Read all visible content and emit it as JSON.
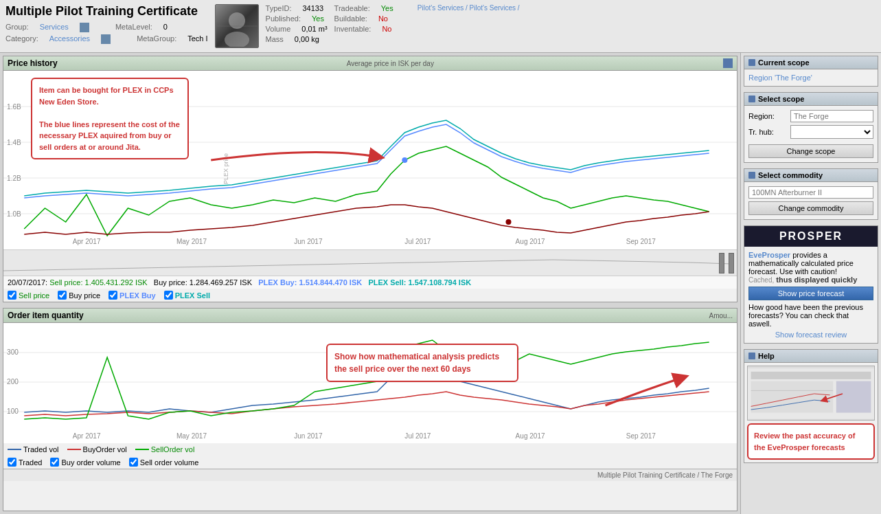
{
  "header": {
    "title": "Multiple Pilot Training Certificate",
    "avatar_alt": "Item Avatar",
    "group_label": "Group:",
    "group_value": "Services",
    "metalevel_label": "MetaLevel:",
    "metalevel_value": "0",
    "category_label": "Category:",
    "category_value": "Accessories",
    "metagroup_label": "MetaGroup:",
    "metagroup_value": "Tech I",
    "typeid_label": "TypeID:",
    "typeid_value": "34133",
    "published_label": "Published:",
    "published_value": "Yes",
    "volume_label": "Volume",
    "volume_value": "0,01 m³",
    "mass_label": "Mass",
    "mass_value": "0,00 kg",
    "tradeable_label": "Tradeable:",
    "tradeable_value": "Yes",
    "buildable_label": "Buildable:",
    "buildable_value": "No",
    "inventable_label": "Inventable:",
    "inventable_value": "No",
    "breadcrumb": "Pilot's Services / Pilot's Services /"
  },
  "price_history": {
    "title": "Price history",
    "avg_label": "Average price in ISK per day",
    "tooltip1": "Item can be bought for PLEX in CCPs New Eden Store.\n\nThe blue lines represent the cost of the necessary PLEX aquired from buy or sell orders at or around Jita.",
    "date_label": "20/07/2017:",
    "sell_label": "Sell price:",
    "sell_value": "1.405.431.292 ISK",
    "buy_label": "Buy price:",
    "buy_value": "1.284.469.257 ISK",
    "plex_buy_label": "PLEX Buy:",
    "plex_buy_value": "1.514.844.470 ISK",
    "plex_sell_label": "PLEX Sell:",
    "plex_sell_value": "1.547.108.794 ISK",
    "cb_sell": "Sell price",
    "cb_buy": "Buy price",
    "cb_plex_buy": "PLEX Buy",
    "cb_plex_sell": "PLEX Sell",
    "x_labels": [
      "Apr 2017",
      "May 2017",
      "Jun 2017",
      "Jul 2017",
      "Aug 2017",
      "Sep 2017"
    ]
  },
  "order_quantity": {
    "title": "Order item quantity",
    "amount_label": "Amou...",
    "legend_traded": "Traded vol",
    "legend_buy": "BuyOrder vol",
    "legend_sell": "SellOrder vol",
    "cb_traded": "Traded",
    "cb_buy_vol": "Buy order volume",
    "cb_sell_vol": "Sell order volume",
    "footer": "Multiple Pilot Training Certificate / The Forge",
    "x_labels": [
      "Apr 2017",
      "May 2017",
      "Jun 2017",
      "Jul 2017",
      "Aug 2017",
      "Sep 2017"
    ],
    "callout": "Show how mathematical analysis predicts the sell price over the next 60 days"
  },
  "sidebar": {
    "current_scope": {
      "title": "Current scope",
      "region": "Region 'The Forge'"
    },
    "select_scope": {
      "title": "Select scope",
      "region_label": "Region:",
      "region_placeholder": "The Forge",
      "trhub_label": "Tr. hub:",
      "button_label": "Change scope"
    },
    "select_commodity": {
      "title": "Select commodity",
      "input_placeholder": "100MN Afterburner II",
      "button_label": "Change commodity"
    },
    "prosper": {
      "title": "PROSPER",
      "description": "EveProsper provides a mathematically calculated price forecast. Use with caution!",
      "cached_text": "Cached,",
      "cached_bold": "thus displayed quickly",
      "button_label": "Show price forecast",
      "review_text": "How good have been the previous forecasts? You can check that aswell.",
      "review_link": "Show forecast review"
    },
    "help": {
      "title": "Help",
      "callout2": "Review the past accuracy of the EveProsper forecasts"
    }
  }
}
